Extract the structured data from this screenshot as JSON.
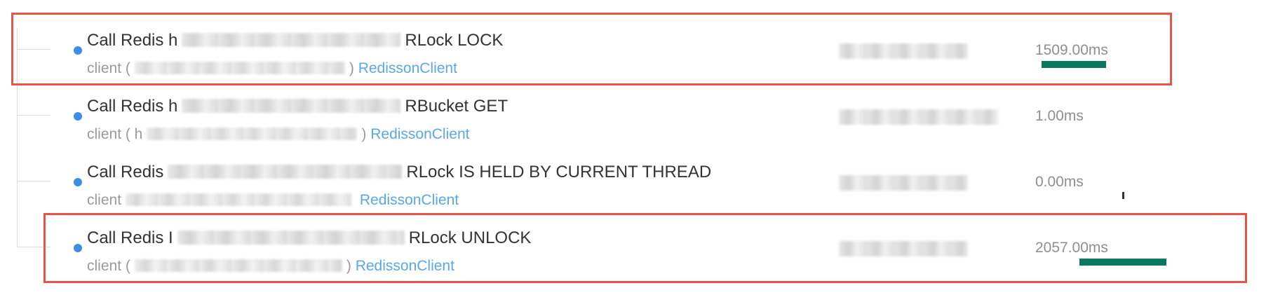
{
  "spans": [
    {
      "title_prefix": "Call Redis h",
      "title_suffix": "RLock LOCK",
      "client_prefix": "client (",
      "client_suffix": ")",
      "client_name": "RedissonClient",
      "duration": "1509.00ms",
      "bar_fraction": 0.37,
      "bar_offset": 0.0,
      "highlighted": true
    },
    {
      "title_prefix": "Call Redis h",
      "title_suffix": "RBucket GET",
      "client_prefix": "client ( h",
      "client_suffix": ")",
      "client_name": "RedissonClient",
      "duration": "1.00ms",
      "bar_fraction": 0.0,
      "bar_offset": 0.0,
      "highlighted": false
    },
    {
      "title_prefix": "Call Redis",
      "title_suffix": "RLock IS HELD BY CURRENT THREAD",
      "client_prefix": "client",
      "client_suffix": "",
      "client_name": "RedissonClient",
      "duration": "0.00ms",
      "bar_fraction": 0.0,
      "bar_offset": 0.0,
      "highlighted": false
    },
    {
      "title_prefix": "Call Redis I",
      "title_suffix": "RLock UNLOCK",
      "client_prefix": "client (",
      "client_suffix": ")",
      "client_name": "RedissonClient",
      "duration": "2057.00ms",
      "bar_fraction": 0.5,
      "bar_offset": 0.37,
      "highlighted": true
    }
  ],
  "colors": {
    "dot": "#3c8dea",
    "link": "#5aa7ea",
    "bar": "#0a7a5f",
    "highlight_border": "#e8534a"
  }
}
